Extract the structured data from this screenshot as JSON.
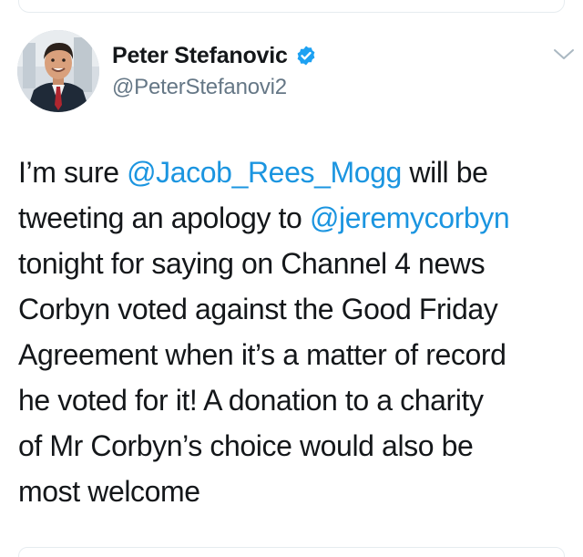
{
  "author": {
    "display_name": "Peter Stefanovic",
    "handle": "@PeterStefanovi2",
    "verified": true,
    "avatar_icon": "profile-photo"
  },
  "colors": {
    "mention": "#1b95e0",
    "verified": "#1da1f2",
    "text": "#14171a",
    "handle": "#657786"
  },
  "tweet": {
    "lines": [
      [
        {
          "text": "I’m sure ",
          "type": "text"
        },
        {
          "text": "@Jacob_Rees_Mogg",
          "type": "mention"
        },
        {
          "text": " will be",
          "type": "text"
        }
      ],
      [
        {
          "text": "tweeting an apology to ",
          "type": "text"
        },
        {
          "text": "@jeremycorbyn",
          "type": "mention"
        }
      ],
      [
        {
          "text": "tonight for saying on Channel 4 news",
          "type": "text"
        }
      ],
      [
        {
          "text": "Corbyn voted against the Good Friday",
          "type": "text"
        }
      ],
      [
        {
          "text": "Agreement when it’s a matter of record",
          "type": "text"
        }
      ],
      [
        {
          "text": "he voted for it! A donation to a charity",
          "type": "text"
        }
      ],
      [
        {
          "text": "of Mr Corbyn’s choice would also be",
          "type": "text"
        }
      ],
      [
        {
          "text": "most welcome",
          "type": "text"
        }
      ]
    ]
  }
}
